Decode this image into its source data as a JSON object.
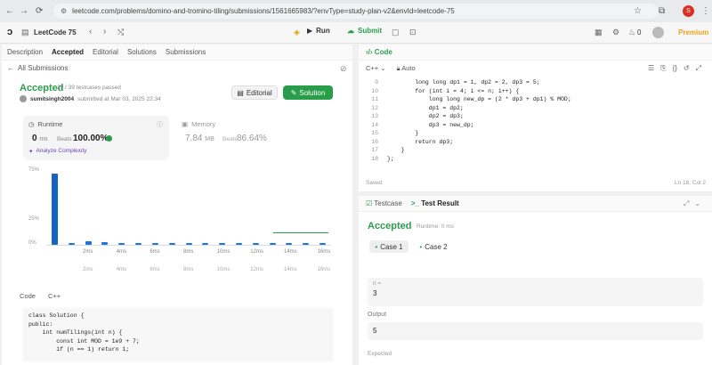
{
  "browser": {
    "url": "leetcode.com/problems/domino-and-tromino-tiling/submissions/1561665983/?envType=study-plan-v2&envId=leetcode-75",
    "avatar_letter": "S"
  },
  "header": {
    "study_plan": "LeetCode 75",
    "run": "Run",
    "submit": "Submit",
    "points": "0",
    "premium": "Premium"
  },
  "left_tabs": [
    "Description",
    "Accepted",
    "Editorial",
    "Solutions",
    "Submissions"
  ],
  "submission": {
    "back": "All Submissions",
    "status": "Accepted",
    "testcases": "39 / 39 testcases passed",
    "user": "sumitsingh2004",
    "submitted": "submitted at Mar 03, 2025 22:34",
    "editorial_btn": "Editorial",
    "solution_btn": "Solution"
  },
  "runtime": {
    "label": "Runtime",
    "value": "0",
    "unit": "ms",
    "beats_label": "Beats",
    "beats": "100.00%",
    "analyze": "Analyze Complexity"
  },
  "memory": {
    "label": "Memory",
    "value": "7.84",
    "unit": "MB",
    "beats_label": "Beats",
    "beats": "86.64%"
  },
  "chart_data": {
    "type": "bar",
    "categories": [
      "0ms",
      "1ms",
      "2ms",
      "3ms",
      "4ms",
      "5ms",
      "6ms",
      "7ms",
      "8ms",
      "9ms",
      "10ms",
      "11ms",
      "12ms",
      "13ms",
      "14ms",
      "15ms",
      "16ms"
    ],
    "x_tick_labels": [
      "2ms",
      "4ms",
      "6ms",
      "8ms",
      "10ms",
      "12ms",
      "14ms",
      "16ms"
    ],
    "values": [
      75,
      2,
      4,
      3,
      1,
      1,
      1,
      1,
      1,
      1,
      1,
      1,
      1,
      1,
      1,
      1,
      1
    ],
    "y_tick_labels": [
      "75%",
      "25%",
      "0%"
    ],
    "ylim": [
      0,
      75
    ]
  },
  "code_section": {
    "label": "Code",
    "lang": "C++",
    "preview": [
      "class Solution {",
      "public:",
      "    int numTilings(int n) {",
      "        const int MOD = 1e9 + 7;",
      "        if (n == 1) return 1;"
    ]
  },
  "editor": {
    "title": "Code",
    "lang": "C++",
    "mode": "Auto",
    "lines": [
      {
        "n": "9",
        "text": "        long long dp1 = 1, dp2 = 2, dp3 = 5;"
      },
      {
        "n": "10",
        "text": "        for (int i = 4; i <= n; i++) {"
      },
      {
        "n": "11",
        "text": "            long long new_dp = (2 * dp3 + dp1) % MOD;"
      },
      {
        "n": "12",
        "text": "            dp1 = dp2;"
      },
      {
        "n": "13",
        "text": "            dp2 = dp3;"
      },
      {
        "n": "14",
        "text": "            dp3 = new_dp;"
      },
      {
        "n": "15",
        "text": "        }"
      },
      {
        "n": "16",
        "text": "        return dp3;"
      },
      {
        "n": "17",
        "text": "    }"
      },
      {
        "n": "18",
        "text": "};"
      }
    ],
    "saved": "Saved",
    "cursor": "Ln 18, Col 2"
  },
  "testpanel": {
    "tab1": "Testcase",
    "tab2": "Test Result",
    "status": "Accepted",
    "runtime": "Runtime: 0 ms",
    "case1": "Case 1",
    "case2": "Case 2",
    "input_label": "n =",
    "input": "3",
    "output_label": "Output",
    "output": "5",
    "expected_label": "Expected"
  }
}
